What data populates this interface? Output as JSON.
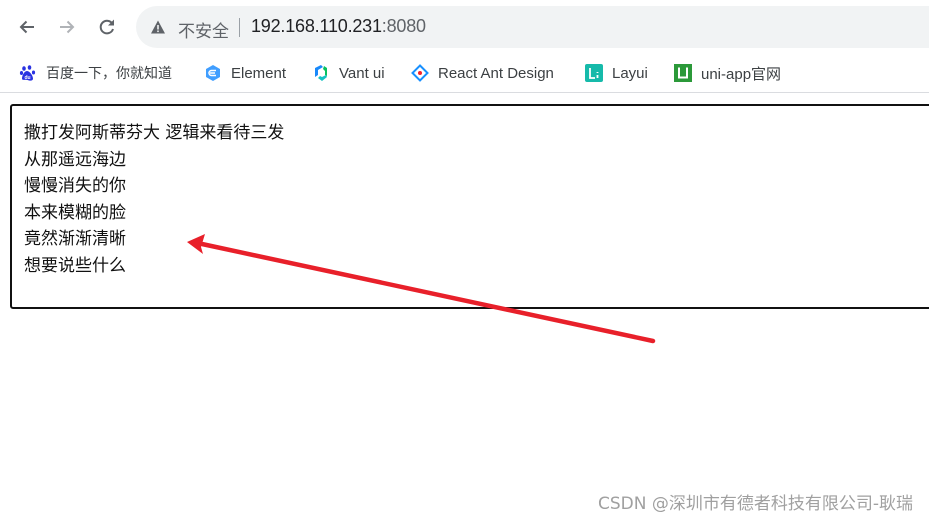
{
  "browser": {
    "nav": {
      "back_icon": "arrow-left-icon",
      "forward_icon": "arrow-right-icon",
      "reload_icon": "reload-icon"
    },
    "omnibox": {
      "security_icon": "warning-triangle-icon",
      "security_label": "不安全",
      "url_host": "192.168.110.231",
      "url_port": ":8080"
    },
    "bookmarks": [
      {
        "label": "百度一下，你就知道",
        "icon": "baidu-paw-icon",
        "color": "#2932e1"
      },
      {
        "label": "Element",
        "icon": "element-hexagon-icon",
        "color": "#409eff"
      },
      {
        "label": "Vant ui",
        "icon": "vant-icon",
        "color": "#07c160"
      },
      {
        "label": "React Ant Design",
        "icon": "ant-design-diamond-icon",
        "color": "#1890ff"
      },
      {
        "label": "Layui",
        "icon": "layui-icon",
        "color": "#16baaa"
      },
      {
        "label": "uni-app官网",
        "icon": "uniapp-u-icon",
        "color": "#2b9939"
      }
    ]
  },
  "page": {
    "lyrics": [
      "撒打发阿斯蒂芬大 逻辑来看待三发",
      "从那遥远海边",
      "慢慢消失的你",
      "本来模糊的脸",
      "竟然渐渐清晰",
      "想要说些什么"
    ],
    "annotation": {
      "type": "arrow",
      "color": "#e8202a",
      "points_to": "lyrics"
    }
  },
  "watermark": "CSDN @深圳市有德者科技有限公司-耿瑞"
}
